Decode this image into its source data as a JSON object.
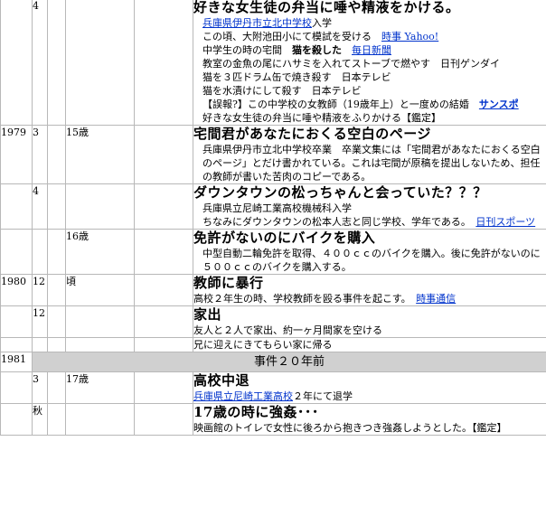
{
  "events": [
    {
      "id": "spit",
      "year": "",
      "month": "4",
      "age": "",
      "title": "好きな女生徒の弁当に唾や精液をかける。",
      "lines": [
        {
          "indent": true,
          "parts": [
            {
              "t": "兵庫県伊丹市立北中学校",
              "link": true
            },
            {
              "t": "入学"
            }
          ]
        },
        {
          "indent": true,
          "parts": [
            {
              "t": "この頃、大附池田小にて模試を受ける　"
            },
            {
              "t": "時事 Yahoo!",
              "link": true
            }
          ]
        },
        {
          "indent": true,
          "parts": [
            {
              "t": "中学生の時の宅間　"
            },
            {
              "t": "猫を殺した",
              "bold": true
            },
            {
              "t": "　"
            },
            {
              "t": "毎日新聞",
              "link": true
            }
          ]
        },
        {
          "indent": true,
          "parts": [
            {
              "t": "教室の金魚の尾にハサミを入れてストーブで燃やす　日刊ゲンダイ"
            }
          ]
        },
        {
          "indent": true,
          "parts": [
            {
              "t": "猫を３匹ドラム缶で焼き殺す　日本テレビ"
            }
          ]
        },
        {
          "indent": true,
          "parts": [
            {
              "t": "猫を水漬けにして殺す　日本テレビ"
            }
          ]
        },
        {
          "indent": true,
          "wrap": true,
          "parts": [
            {
              "t": "【誤報?】この中学校の女教師（19歳年上）と一度めの結婚　"
            },
            {
              "t": "サンスポ",
              "link": true,
              "bold": true
            }
          ]
        },
        {
          "indent": true,
          "parts": [
            {
              "t": "好きな女生徒の弁当に唾や精液をふりかける【鑑定】"
            }
          ]
        }
      ]
    },
    {
      "id": "blank-page",
      "year": "1979",
      "month": "3",
      "age": "15歳",
      "title": "宅間君があなたにおくる空白のページ",
      "lines": [
        {
          "indent": true,
          "wrap": true,
          "parts": [
            {
              "t": "兵庫県伊丹市立北中学校卒業　卒業文集には「宅間君があなたにおくる空白のページ」とだけ書かれている。これは宅間が原稿を提出しないため、担任の教師が書いた苦肉のコピーである。"
            }
          ]
        }
      ]
    },
    {
      "id": "downtown",
      "year": "",
      "month": "4",
      "age": "",
      "title": "ダウンタウンの松っちゃんと会っていた？？？",
      "lines": [
        {
          "indent": true,
          "parts": [
            {
              "t": "兵庫県立尼崎工業高校機械科入学"
            }
          ]
        },
        {
          "indent": true,
          "wrap": true,
          "parts": [
            {
              "t": "ちなみにダウンタウンの松本人志と同じ学校、学年である。　"
            },
            {
              "t": "日刊スポーツ",
              "link": true
            }
          ]
        }
      ]
    },
    {
      "id": "bike",
      "year": "",
      "month": "",
      "age": "16歳",
      "title": "免許がないのにバイクを購入",
      "lines": [
        {
          "indent": true,
          "wrap": true,
          "parts": [
            {
              "t": "中型自動二輪免許を取得、４００ｃｃのバイクを購入。後に免許がないのに５００ｃｃのバイクを購入する。"
            }
          ]
        }
      ]
    },
    {
      "id": "teacher-violence",
      "year": "1980",
      "month": "12",
      "age": "頃",
      "title": "教師に暴行",
      "lines": [
        {
          "indent": false,
          "parts": [
            {
              "t": "高校２年生の時、学校教師を殴る事件を起こす。　"
            },
            {
              "t": "時事通信",
              "link": true
            }
          ]
        }
      ]
    },
    {
      "id": "runaway",
      "year": "",
      "month": "12",
      "age": "",
      "title": "家出",
      "lines": [
        {
          "indent": false,
          "parts": [
            {
              "t": "友人と２人で家出、約一ヶ月間家を空ける"
            }
          ]
        }
      ]
    },
    {
      "id": "brought-home",
      "year": "",
      "month": "",
      "age": "",
      "title": "",
      "lines": [
        {
          "indent": false,
          "parts": [
            {
              "t": "兄に迎えにきてもらい家に帰る"
            }
          ]
        }
      ]
    },
    {
      "id": "dropout",
      "year": "",
      "month": "3",
      "age": "17歳",
      "title": "高校中退",
      "lines": [
        {
          "indent": false,
          "parts": [
            {
              "t": "兵庫県立尼崎工業高校",
              "link": true
            },
            {
              "t": "２年にて退学"
            }
          ]
        }
      ]
    },
    {
      "id": "assault",
      "year": "",
      "month": "秋",
      "age": "",
      "title": "17歳の時に強姦･･･",
      "lines": [
        {
          "indent": false,
          "parts": [
            {
              "t": "映画館のトイレで女性に後ろから抱きつき強姦しようとした。【鑑定】"
            }
          ]
        }
      ]
    }
  ],
  "separator": {
    "year": "1981",
    "label": "事件２０年前"
  }
}
